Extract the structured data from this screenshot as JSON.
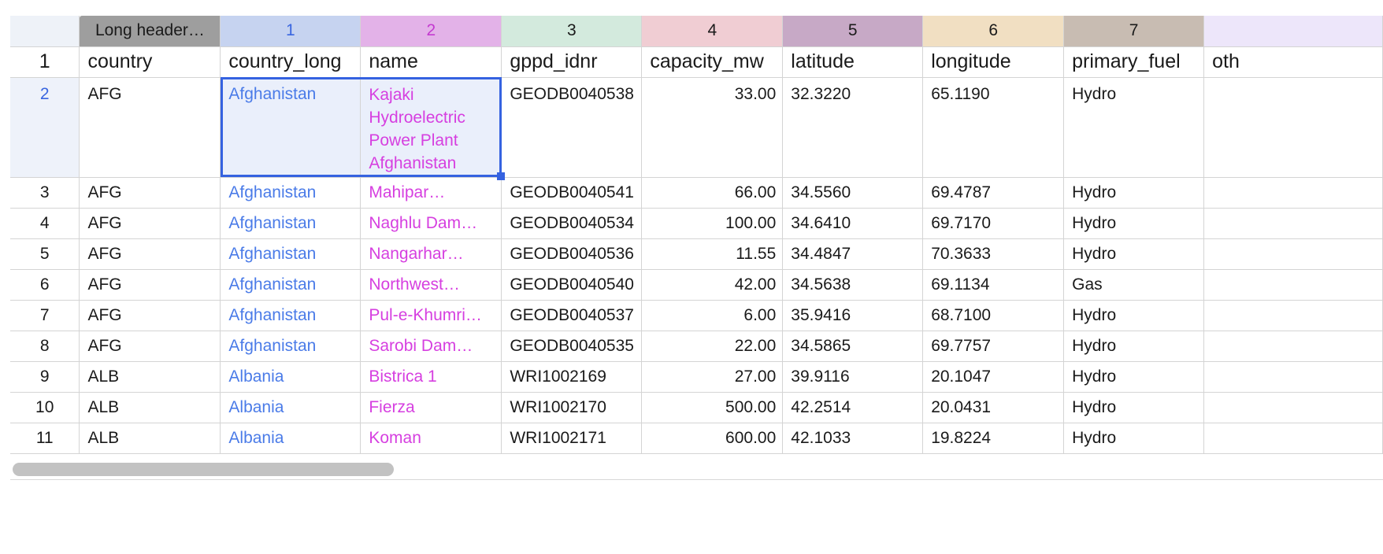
{
  "column_headers": [
    "Long header…",
    "1",
    "2",
    "3",
    "4",
    "5",
    "6",
    "7",
    ""
  ],
  "field_names": [
    "country",
    "country_long",
    "name",
    "gppd_idnr",
    "capacity_mw",
    "latitude",
    "longitude",
    "primary_fuel",
    "oth"
  ],
  "row_numbers": [
    "1",
    "2",
    "3",
    "4",
    "5",
    "6",
    "7",
    "8",
    "9",
    "10",
    "11"
  ],
  "rows": [
    {
      "country": "AFG",
      "country_long": "Afghanistan",
      "name": "Kajaki Hydroelectric Power Plant Afghanistan",
      "gppd_idnr": "GEODB0040538",
      "capacity_mw": "33.00",
      "latitude": "32.3220",
      "longitude": "65.1190",
      "primary_fuel": "Hydro",
      "other": ""
    },
    {
      "country": "AFG",
      "country_long": "Afghanistan",
      "name": "Mahipar…",
      "gppd_idnr": "GEODB0040541",
      "capacity_mw": "66.00",
      "latitude": "34.5560",
      "longitude": "69.4787",
      "primary_fuel": "Hydro",
      "other": ""
    },
    {
      "country": "AFG",
      "country_long": "Afghanistan",
      "name": "Naghlu Dam…",
      "gppd_idnr": "GEODB0040534",
      "capacity_mw": "100.00",
      "latitude": "34.6410",
      "longitude": "69.7170",
      "primary_fuel": "Hydro",
      "other": ""
    },
    {
      "country": "AFG",
      "country_long": "Afghanistan",
      "name": "Nangarhar…",
      "gppd_idnr": "GEODB0040536",
      "capacity_mw": "11.55",
      "latitude": "34.4847",
      "longitude": "70.3633",
      "primary_fuel": "Hydro",
      "other": ""
    },
    {
      "country": "AFG",
      "country_long": "Afghanistan",
      "name": "Northwest…",
      "gppd_idnr": "GEODB0040540",
      "capacity_mw": "42.00",
      "latitude": "34.5638",
      "longitude": "69.1134",
      "primary_fuel": "Gas",
      "other": ""
    },
    {
      "country": "AFG",
      "country_long": "Afghanistan",
      "name": "Pul-e-Khumri…",
      "gppd_idnr": "GEODB0040537",
      "capacity_mw": "6.00",
      "latitude": "35.9416",
      "longitude": "68.7100",
      "primary_fuel": "Hydro",
      "other": ""
    },
    {
      "country": "AFG",
      "country_long": "Afghanistan",
      "name": "Sarobi Dam…",
      "gppd_idnr": "GEODB0040535",
      "capacity_mw": "22.00",
      "latitude": "34.5865",
      "longitude": "69.7757",
      "primary_fuel": "Hydro",
      "other": ""
    },
    {
      "country": "ALB",
      "country_long": "Albania",
      "name": "Bistrica 1",
      "gppd_idnr": "WRI1002169",
      "capacity_mw": "27.00",
      "latitude": "39.9116",
      "longitude": "20.1047",
      "primary_fuel": "Hydro",
      "other": ""
    },
    {
      "country": "ALB",
      "country_long": "Albania",
      "name": "Fierza",
      "gppd_idnr": "WRI1002170",
      "capacity_mw": "500.00",
      "latitude": "42.2514",
      "longitude": "20.0431",
      "primary_fuel": "Hydro",
      "other": ""
    },
    {
      "country": "ALB",
      "country_long": "Albania",
      "name": "Koman",
      "gppd_idnr": "WRI1002171",
      "capacity_mw": "600.00",
      "latitude": "42.1033",
      "longitude": "19.8224",
      "primary_fuel": "Hydro",
      "other": ""
    }
  ],
  "colors": {
    "selection": "#3562e0",
    "country_long_text": "#4a7be8",
    "name_text": "#d63fe0"
  }
}
